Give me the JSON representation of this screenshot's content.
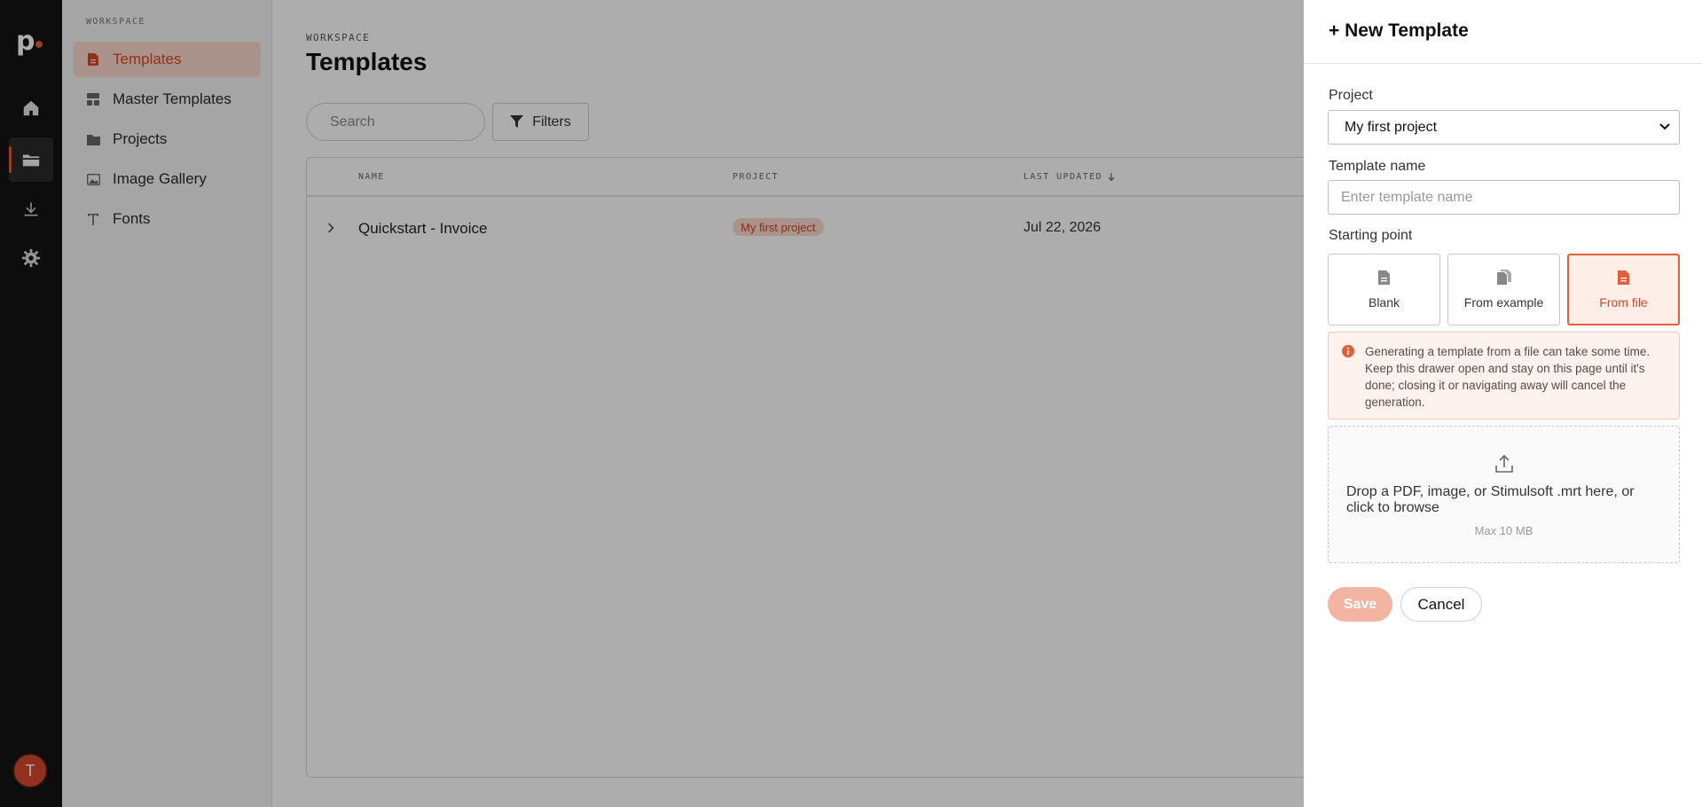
{
  "accent_color": "#e05b3a",
  "rail": {
    "items": [
      {
        "icon": "home-icon"
      },
      {
        "icon": "folder-icon",
        "active": true
      },
      {
        "icon": "download-icon"
      },
      {
        "icon": "gear-icon"
      }
    ],
    "avatar_initial": "T"
  },
  "sidebar": {
    "section_label": "WORKSPACE",
    "items": [
      {
        "label": "Templates",
        "icon": "file-icon",
        "active": true
      },
      {
        "label": "Master Templates",
        "icon": "layout-icon"
      },
      {
        "label": "Projects",
        "icon": "folder-icon"
      },
      {
        "label": "Image Gallery",
        "icon": "image-icon"
      },
      {
        "label": "Fonts",
        "icon": "type-icon"
      }
    ]
  },
  "main": {
    "eyebrow": "WORKSPACE",
    "title": "Templates",
    "search_placeholder": "Search",
    "filters_label": "Filters",
    "table": {
      "columns": [
        "NAME",
        "PROJECT",
        "LAST UPDATED"
      ],
      "sort_column": "LAST UPDATED",
      "rows": [
        {
          "name": "Quickstart - Invoice",
          "project": "My first project",
          "updated": "Jul 22, 2026"
        }
      ]
    }
  },
  "drawer": {
    "title": "+ New Template",
    "project_label": "Project",
    "project_value": "My first project",
    "template_name_label": "Template name",
    "template_name_placeholder": "Enter template name",
    "starting_point_label": "Starting point",
    "starting_points": [
      {
        "label": "Blank",
        "icon": "file-icon"
      },
      {
        "label": "From example",
        "icon": "copy-icon"
      },
      {
        "label": "From file",
        "icon": "file-icon",
        "selected": true
      }
    ],
    "alert_text": "Generating a template from a file can take some time. Keep this drawer open and stay on this page until it's done; closing it or navigating away will cancel the generation.",
    "dropzone_text": "Drop a PDF, image, or Stimulsoft .mrt here, or click to browse",
    "dropzone_hint": "Max 10 MB",
    "save_label": "Save",
    "cancel_label": "Cancel"
  }
}
